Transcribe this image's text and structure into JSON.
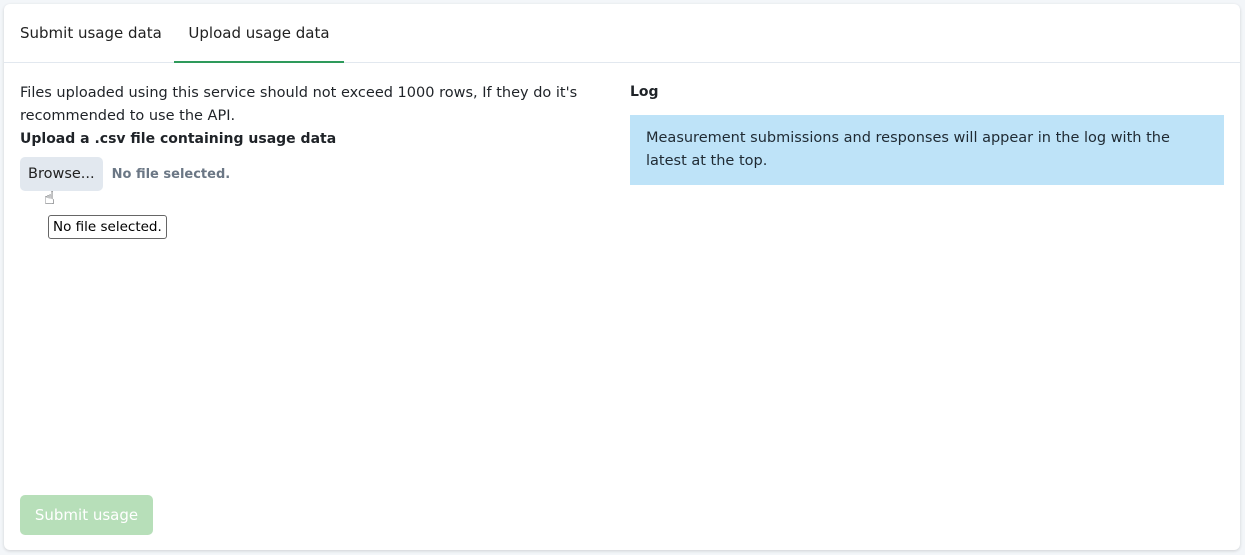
{
  "tabs": [
    {
      "label": "Submit usage data",
      "active": false
    },
    {
      "label": "Upload usage data",
      "active": true
    }
  ],
  "upload": {
    "notice": "Files uploaded using this service should not exceed 1000 rows, If they do it's recommended to use the API.",
    "label": "Upload a .csv file containing usage data",
    "browse_label": "Browse...",
    "file_status": "No file selected.",
    "tooltip": "No file selected."
  },
  "log": {
    "title": "Log",
    "message": "Measurement submissions and responses will appear in the log with the latest at the top."
  },
  "submit_label": "Submit usage",
  "colors": {
    "accent": "#2e9a5b",
    "log_bg": "#bee3f8",
    "submit_disabled": "#b7dfb9"
  }
}
